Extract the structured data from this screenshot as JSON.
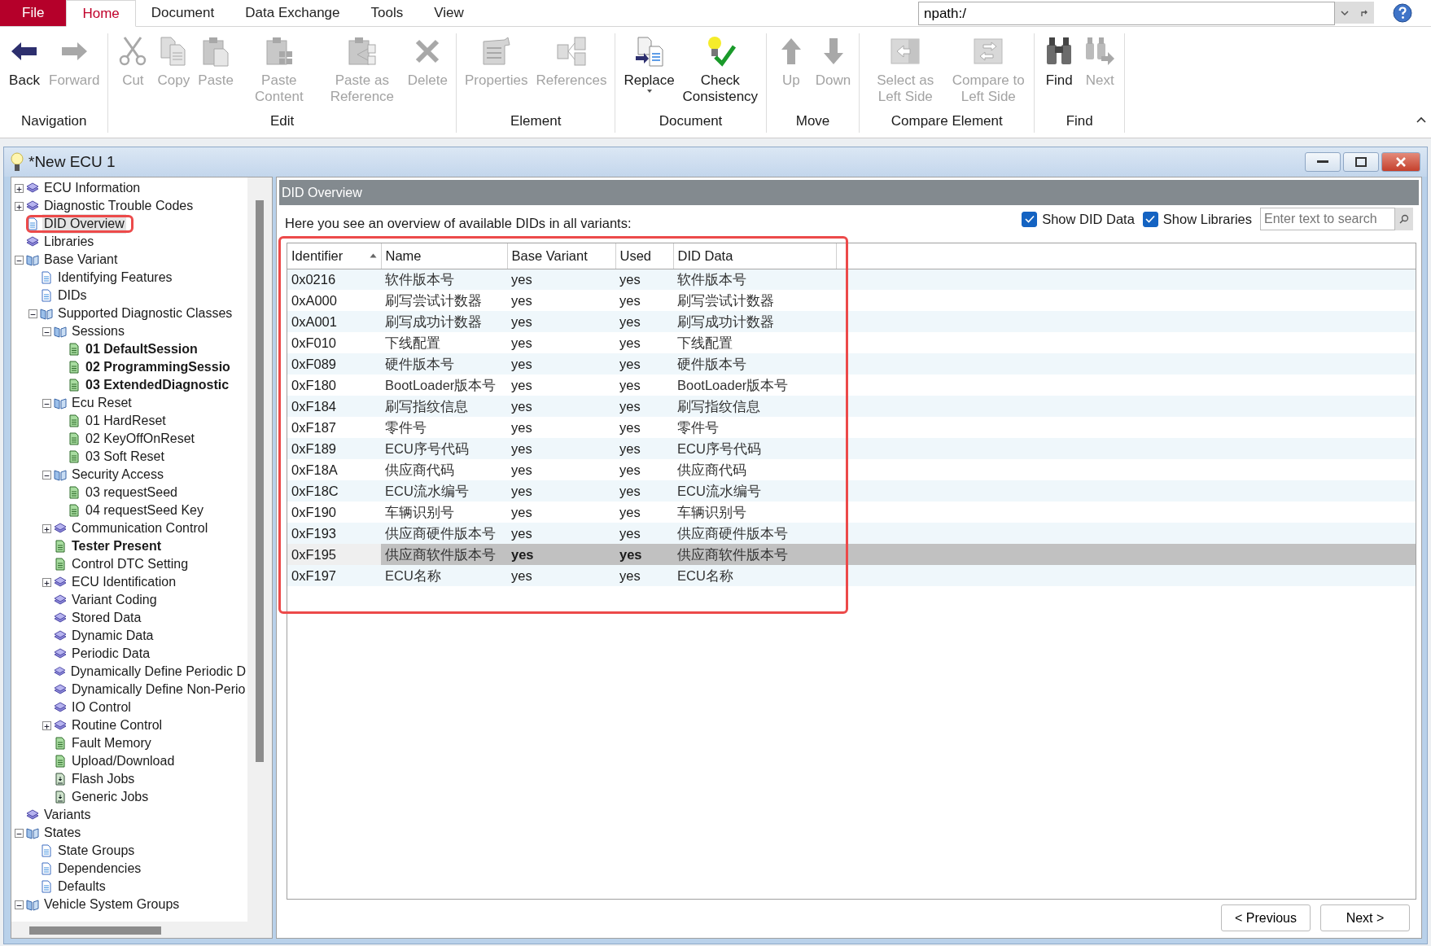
{
  "menu_tabs": [
    {
      "label": "File",
      "kind": "file",
      "selected": false
    },
    {
      "label": "Home",
      "kind": "tab",
      "selected": true
    },
    {
      "label": "Document",
      "kind": "tab",
      "selected": false
    },
    {
      "label": "Data Exchange",
      "kind": "tab",
      "selected": false
    },
    {
      "label": "Tools",
      "kind": "tab",
      "selected": false
    },
    {
      "label": "View",
      "kind": "tab",
      "selected": false
    }
  ],
  "path_field": {
    "value": "npath:/"
  },
  "ribbon_groups": [
    {
      "label": "Navigation",
      "buttons": [
        {
          "label": "Back",
          "disabled": false
        },
        {
          "label": "Forward",
          "disabled": true
        }
      ]
    },
    {
      "label": "Edit",
      "buttons": [
        {
          "label": "Cut",
          "disabled": true
        },
        {
          "label": "Copy",
          "disabled": true
        },
        {
          "label": "Paste",
          "disabled": true
        },
        {
          "label": "Paste Content",
          "disabled": true
        },
        {
          "label": "Paste as Reference",
          "disabled": true
        },
        {
          "label": "Delete",
          "disabled": true
        }
      ]
    },
    {
      "label": "Element",
      "buttons": [
        {
          "label": "Properties",
          "disabled": true
        },
        {
          "label": "References",
          "disabled": true
        }
      ]
    },
    {
      "label": "Document",
      "buttons": [
        {
          "label": "Replace",
          "disabled": false,
          "dropdown": true
        },
        {
          "label": "Check Consistency",
          "disabled": false
        }
      ]
    },
    {
      "label": "Move",
      "buttons": [
        {
          "label": "Up",
          "disabled": true
        },
        {
          "label": "Down",
          "disabled": true
        }
      ]
    },
    {
      "label": "Compare Element",
      "buttons": [
        {
          "label": "Select as Left Side",
          "disabled": true
        },
        {
          "label": "Compare to Left Side",
          "disabled": true
        }
      ]
    },
    {
      "label": "Find",
      "buttons": [
        {
          "label": "Find",
          "disabled": false
        },
        {
          "label": "Next",
          "disabled": true
        }
      ]
    }
  ],
  "window": {
    "title": "*New ECU 1"
  },
  "tree": [
    {
      "label": "ECU Information",
      "kind": "book",
      "bold": false,
      "selected": false,
      "expanded": false
    },
    {
      "label": "Diagnostic Trouble Codes",
      "kind": "book",
      "bold": false,
      "selected": false,
      "expanded": false
    },
    {
      "label": "DID Overview",
      "kind": "page",
      "bold": false,
      "selected": true,
      "highlighted": true
    },
    {
      "label": "Libraries",
      "kind": "book",
      "bold": false,
      "selected": false
    },
    {
      "label": "Base Variant",
      "kind": "open-book",
      "bold": false,
      "selected": false,
      "expanded": true,
      "children": [
        {
          "label": "Identifying Features",
          "kind": "page",
          "bold": false,
          "selected": false
        },
        {
          "label": "DIDs",
          "kind": "page",
          "bold": false,
          "selected": false
        },
        {
          "label": "Supported Diagnostic Classes",
          "kind": "open-book",
          "bold": false,
          "selected": false,
          "expanded": true,
          "children": [
            {
              "label": "Sessions",
              "kind": "open-book",
              "bold": false,
              "selected": false,
              "expanded": true,
              "children": [
                {
                  "label": "01 DefaultSession",
                  "kind": "green-page",
                  "bold": true,
                  "selected": false
                },
                {
                  "label": "02 ProgrammingSessio",
                  "kind": "green-page",
                  "bold": true,
                  "selected": false
                },
                {
                  "label": "03 ExtendedDiagnostic",
                  "kind": "green-page",
                  "bold": true,
                  "selected": false
                }
              ]
            },
            {
              "label": "Ecu Reset",
              "kind": "open-book",
              "bold": false,
              "selected": false,
              "expanded": true,
              "children": [
                {
                  "label": "01 HardReset",
                  "kind": "green-page",
                  "bold": false,
                  "selected": false
                },
                {
                  "label": "02 KeyOffOnReset",
                  "kind": "green-page",
                  "bold": false,
                  "selected": false
                },
                {
                  "label": "03 Soft Reset",
                  "kind": "green-page",
                  "bold": false,
                  "selected": false
                }
              ]
            },
            {
              "label": "Security Access",
              "kind": "open-book",
              "bold": false,
              "selected": false,
              "expanded": true,
              "children": [
                {
                  "label": "03 requestSeed",
                  "kind": "green-page",
                  "bold": false,
                  "selected": false
                },
                {
                  "label": "04 requestSeed Key",
                  "kind": "green-page",
                  "bold": false,
                  "selected": false
                }
              ]
            },
            {
              "label": "Communication Control",
              "kind": "book",
              "bold": false,
              "selected": false,
              "expanded": false
            },
            {
              "label": "Tester Present",
              "kind": "green-page",
              "bold": true,
              "selected": false
            },
            {
              "label": "Control DTC Setting",
              "kind": "green-page",
              "bold": false,
              "selected": false
            },
            {
              "label": "ECU Identification",
              "kind": "book",
              "bold": false,
              "selected": false,
              "expanded": false
            },
            {
              "label": "Variant Coding",
              "kind": "book",
              "bold": false,
              "selected": false
            },
            {
              "label": "Stored Data",
              "kind": "book",
              "bold": false,
              "selected": false
            },
            {
              "label": "Dynamic Data",
              "kind": "book",
              "bold": false,
              "selected": false
            },
            {
              "label": "Periodic Data",
              "kind": "book",
              "bold": false,
              "selected": false
            },
            {
              "label": "Dynamically Define Periodic D",
              "kind": "book",
              "bold": false,
              "selected": false
            },
            {
              "label": "Dynamically Define Non-Perio",
              "kind": "book",
              "bold": false,
              "selected": false
            },
            {
              "label": "IO Control",
              "kind": "book",
              "bold": false,
              "selected": false
            },
            {
              "label": "Routine Control",
              "kind": "book",
              "bold": false,
              "selected": false,
              "expanded": false
            },
            {
              "label": "Fault Memory",
              "kind": "green-page",
              "bold": false,
              "selected": false
            },
            {
              "label": "Upload/Download",
              "kind": "green-page",
              "bold": false,
              "selected": false
            },
            {
              "label": "Flash Jobs",
              "kind": "job",
              "bold": false,
              "selected": false
            },
            {
              "label": "Generic Jobs",
              "kind": "job",
              "bold": false,
              "selected": false
            }
          ]
        }
      ]
    },
    {
      "label": "Variants",
      "kind": "book",
      "bold": false,
      "selected": false
    },
    {
      "label": "States",
      "kind": "open-book",
      "bold": false,
      "selected": false,
      "expanded": true,
      "children": [
        {
          "label": "State Groups",
          "kind": "page",
          "bold": false,
          "selected": false
        },
        {
          "label": "Dependencies",
          "kind": "page",
          "bold": false,
          "selected": false
        },
        {
          "label": "Defaults",
          "kind": "page",
          "bold": false,
          "selected": false
        }
      ]
    },
    {
      "label": "Vehicle System Groups",
      "kind": "open-book",
      "bold": false,
      "selected": false,
      "expanded": true
    }
  ],
  "panel": {
    "title": "DID Overview",
    "description": "Here you see an overview of available DIDs in all variants:",
    "checkboxes": [
      {
        "label": "Show DID Data",
        "checked": true
      },
      {
        "label": "Show Libraries",
        "checked": true
      }
    ],
    "search": {
      "placeholder": "Enter text to search"
    }
  },
  "table": {
    "highlighted": true,
    "columns": [
      {
        "label": "Identifier",
        "sorted": true
      },
      {
        "label": "Name",
        "sorted": false
      },
      {
        "label": "Base Variant",
        "sorted": false
      },
      {
        "label": "Used",
        "sorted": false
      },
      {
        "label": "DID Data",
        "sorted": false
      }
    ],
    "rows": [
      {
        "cells": [
          "0x0216",
          "软件版本号",
          "yes",
          "yes",
          "软件版本号"
        ],
        "selected": false
      },
      {
        "cells": [
          "0xA000",
          "刷写尝试计数器",
          "yes",
          "yes",
          "刷写尝试计数器"
        ],
        "selected": false
      },
      {
        "cells": [
          "0xA001",
          "刷写成功计数器",
          "yes",
          "yes",
          "刷写成功计数器"
        ],
        "selected": false
      },
      {
        "cells": [
          "0xF010",
          "下线配置",
          "yes",
          "yes",
          "下线配置"
        ],
        "selected": false
      },
      {
        "cells": [
          "0xF089",
          "硬件版本号",
          "yes",
          "yes",
          "硬件版本号"
        ],
        "selected": false
      },
      {
        "cells": [
          "0xF180",
          "BootLoader版本号",
          "yes",
          "yes",
          "BootLoader版本号"
        ],
        "selected": false
      },
      {
        "cells": [
          "0xF184",
          "刷写指纹信息",
          "yes",
          "yes",
          "刷写指纹信息"
        ],
        "selected": false
      },
      {
        "cells": [
          "0xF187",
          "零件号",
          "yes",
          "yes",
          "零件号"
        ],
        "selected": false
      },
      {
        "cells": [
          "0xF189",
          "ECU序号代码",
          "yes",
          "yes",
          "ECU序号代码"
        ],
        "selected": false
      },
      {
        "cells": [
          "0xF18A",
          "供应商代码",
          "yes",
          "yes",
          "供应商代码"
        ],
        "selected": false
      },
      {
        "cells": [
          "0xF18C",
          "ECU流水编号",
          "yes",
          "yes",
          "ECU流水编号"
        ],
        "selected": false
      },
      {
        "cells": [
          "0xF190",
          "车辆识别号",
          "yes",
          "yes",
          "车辆识别号"
        ],
        "selected": false
      },
      {
        "cells": [
          "0xF193",
          "供应商硬件版本号",
          "yes",
          "yes",
          "供应商硬件版本号"
        ],
        "selected": false
      },
      {
        "cells": [
          "0xF195",
          "供应商软件版本号",
          "yes",
          "yes",
          "供应商软件版本号"
        ],
        "selected": true
      },
      {
        "cells": [
          "0xF197",
          "ECU名称",
          "yes",
          "yes",
          "ECU名称"
        ],
        "selected": false
      }
    ]
  },
  "buttons": [
    {
      "label": "< Previous"
    },
    {
      "label": "Next >"
    }
  ]
}
